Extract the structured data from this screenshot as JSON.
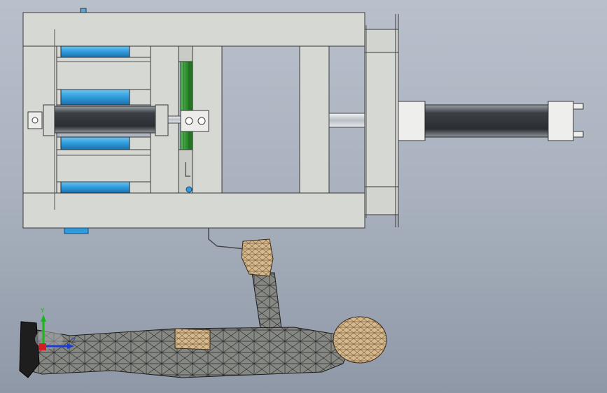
{
  "viewport": {
    "background_top": "#b9c0cc",
    "background_bottom": "#8f98a7"
  },
  "model": {
    "frame_color": "#d6d8d4",
    "outline_color": "#3a3a3a",
    "blue_part_color": "#2e9bdc",
    "green_part_color": "#2f8d2f",
    "cylinder_dark": "#3d4247",
    "rod_color": "#d9dde2",
    "mannequin_body": "#7d7f79",
    "mannequin_head": "#d7b98e"
  },
  "triad": {
    "y_label": "Y",
    "z_label": "Z",
    "x_color": "#d21e1e",
    "y_color": "#18b818",
    "z_color": "#1e3cd2"
  }
}
